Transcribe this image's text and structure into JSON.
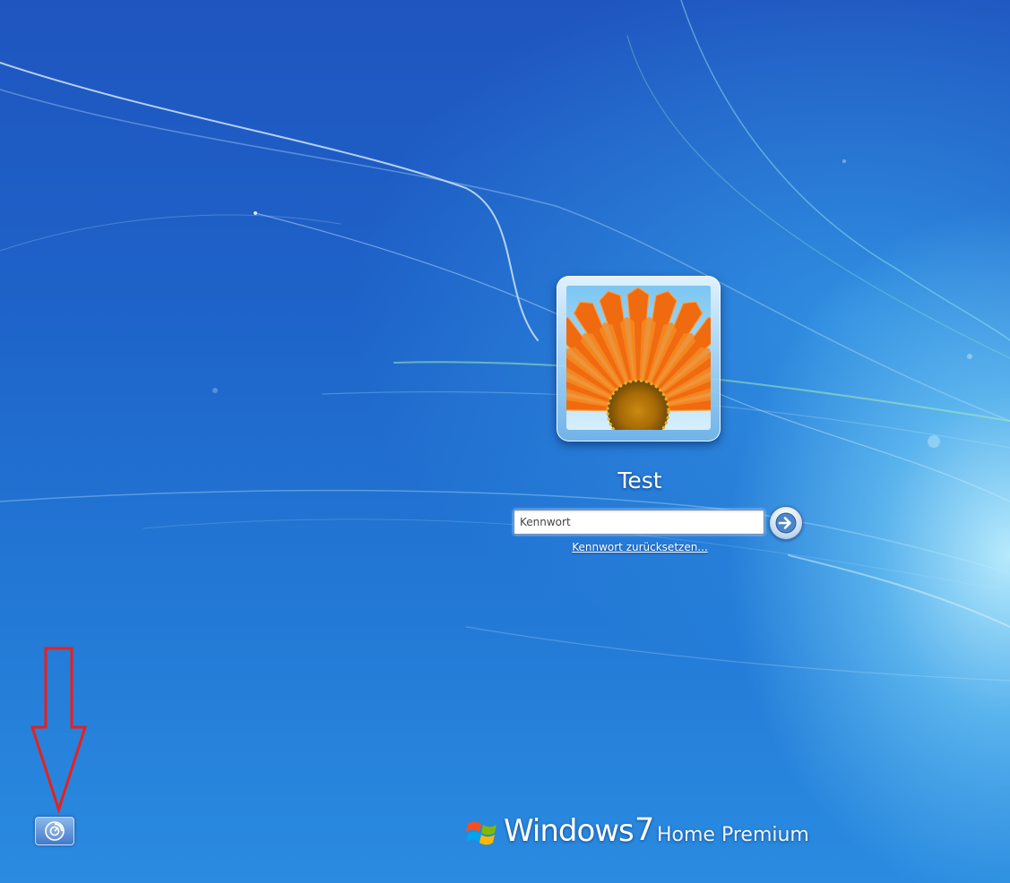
{
  "logon": {
    "user_name": "Test",
    "password_placeholder": "Kennwort",
    "password_value": "",
    "reset_link": "Kennwort zurücksetzen..."
  },
  "branding": {
    "windows": "Windows",
    "version": "7",
    "edition": "Home Premium"
  },
  "icons": {
    "user_picture": "orange-flower-picture",
    "submit": "arrow-right-icon",
    "ease_of_access": "ease-of-access-icon",
    "annotation": "red-down-arrow",
    "logo": "windows-flag-logo"
  },
  "colors": {
    "background_top": "#1f55bf",
    "background_glow": "#bef0ff",
    "annotation_arrow": "#e8201c"
  }
}
